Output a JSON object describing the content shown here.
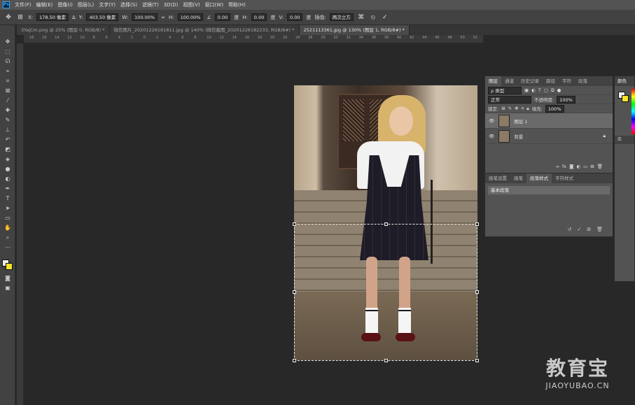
{
  "menubar": {
    "app_logo": "Ps",
    "items": [
      "文件(F)",
      "编辑(E)",
      "图像(I)",
      "图层(L)",
      "文字(Y)",
      "选择(S)",
      "滤镜(T)",
      "3D(D)",
      "视图(V)",
      "窗口(W)",
      "帮助(H)"
    ]
  },
  "options": {
    "x_label": "X:",
    "x_value": "178.50 像素",
    "y_label": "Y:",
    "y_value": "403.50 像素",
    "w_label": "W:",
    "w_value": "100.00%",
    "h_label": "H:",
    "h_value": "100.00%",
    "angle_value": "0.00",
    "angle_unit": "度",
    "hskew_label": "H:",
    "hskew_value": "0.00",
    "hskew_unit": "度",
    "vskew_label": "V:",
    "vskew_value": "0.00",
    "vskew_unit": "度",
    "interp_label": "插值:",
    "interp_value": "两次立方",
    "cancel_icon": "cancel-icon",
    "commit_icon": "check-icon"
  },
  "tabs": [
    {
      "label": "3YajCm.png @ 25% (图层 0, RGB/8) *"
    },
    {
      "label": "微信图片_20201226181811.jpg @ 140% (微信截图_20201226182233, RGB/8#) *"
    },
    {
      "label": "2521113361.jpg @ 130% (图层 1, RGB/8#) *"
    }
  ],
  "ruler": {
    "ticks": [
      "18",
      "16",
      "14",
      "12",
      "10",
      "8",
      "6",
      "4",
      "2",
      "0",
      "2",
      "4",
      "6",
      "8",
      "10",
      "12",
      "14",
      "16",
      "18",
      "20",
      "22",
      "24",
      "26",
      "28",
      "30",
      "32",
      "34",
      "36",
      "38",
      "40",
      "42",
      "44",
      "46",
      "48",
      "50",
      "52"
    ]
  },
  "layers_panel": {
    "tabs": [
      "图层",
      "通道",
      "历史记录",
      "路径",
      "字符",
      "段落"
    ],
    "filter_label": "ρ 类型",
    "blend_mode": "正常",
    "opacity_label": "不透明度:",
    "opacity_value": "100%",
    "lock_label": "锁定:",
    "fill_label": "填充:",
    "fill_value": "100%",
    "layers": [
      {
        "name": "图层 1",
        "selected": true
      },
      {
        "name": "背景",
        "selected": false
      }
    ]
  },
  "para_panel": {
    "tabs": [
      "画笔设置",
      "画笔",
      "段落样式",
      "字符样式"
    ],
    "item": "基本段落"
  },
  "color_panel": {
    "tab": "颜色",
    "tab2": "库",
    "fg_color": "#f0f0f0",
    "bg_color": "#f5e32a"
  },
  "watermark": {
    "cn": "教育宝",
    "url": "JIAOYUBAO.CN"
  }
}
